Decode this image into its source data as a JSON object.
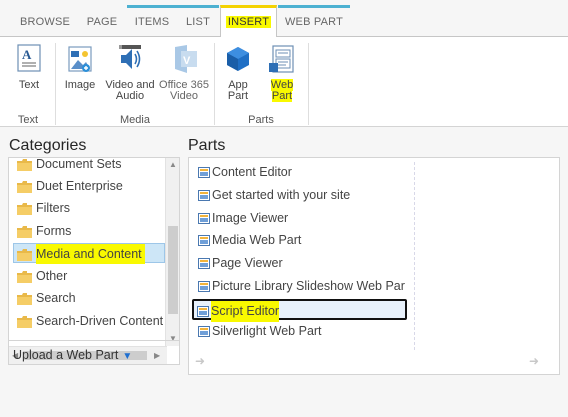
{
  "tabs": [
    {
      "label": "BROWSE"
    },
    {
      "label": "PAGE"
    },
    {
      "label": "ITEMS"
    },
    {
      "label": "LIST"
    },
    {
      "label": "INSERT"
    },
    {
      "label": "WEB PART"
    }
  ],
  "ribbon": {
    "buttons": {
      "text": "Text",
      "image": "Image",
      "video_line1": "Video and",
      "video_line2": "Audio",
      "o365_line1": "Office 365",
      "o365_line2": "Video",
      "apppart_line1": "App",
      "apppart_line2": "Part",
      "webpart_line1": "Web",
      "webpart_line2": "Part"
    },
    "groups": {
      "text": "Text",
      "media": "Media",
      "parts": "Parts"
    }
  },
  "categories": {
    "heading": "Categories",
    "items": [
      {
        "label": "Document Sets"
      },
      {
        "label": "Duet Enterprise"
      },
      {
        "label": "Filters"
      },
      {
        "label": "Forms"
      },
      {
        "label": "Media and Content"
      },
      {
        "label": "Other"
      },
      {
        "label": "Search"
      },
      {
        "label": "Search-Driven Content"
      }
    ],
    "selected": "Media and Content",
    "upload_label": "Upload a Web Part"
  },
  "parts": {
    "heading": "Parts",
    "items": [
      {
        "label": "Content Editor"
      },
      {
        "label": "Get started with your site"
      },
      {
        "label": "Image Viewer"
      },
      {
        "label": "Media Web Part"
      },
      {
        "label": "Page Viewer"
      },
      {
        "label": "Picture Library Slideshow Web Par"
      },
      {
        "label": "Script Editor"
      },
      {
        "label": "Silverlight Web Part"
      }
    ],
    "selected": "Script Editor"
  },
  "colors": {
    "accent_cyan": "#4db1d1",
    "accent_yellow": "#f4d200",
    "highlight": "#f9f900",
    "selection": "#cde6f7"
  }
}
